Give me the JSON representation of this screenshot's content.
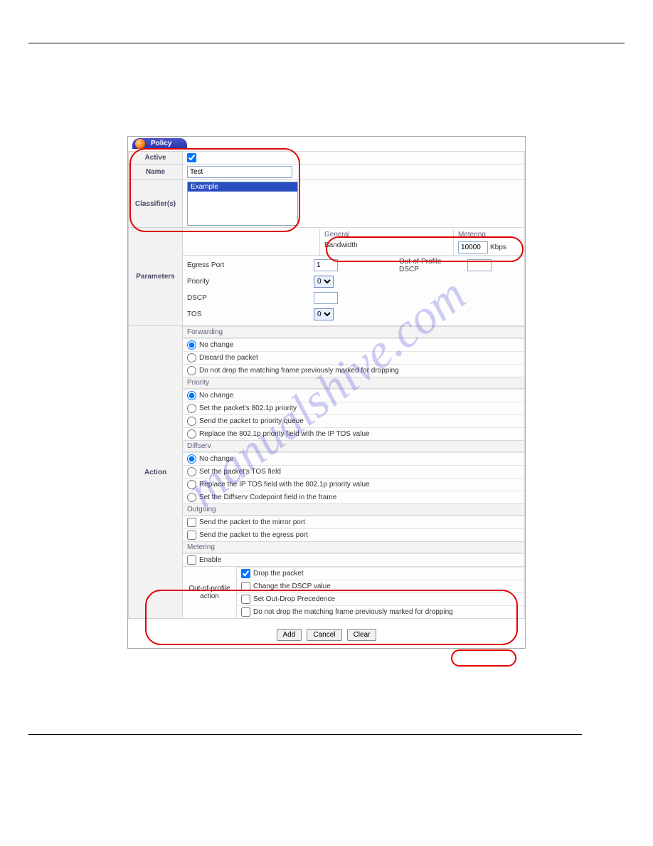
{
  "watermark": "manualshive.com",
  "tab_title": "Policy",
  "rows": {
    "active": {
      "label": "Active",
      "checked": true
    },
    "name": {
      "label": "Name",
      "value": "Test"
    },
    "classifiers": {
      "label": "Classifier(s)",
      "item": "Example"
    }
  },
  "parameters": {
    "label": "Parameters",
    "general": "General",
    "metering": "Metering",
    "bandwidth_label": "Bandwidth",
    "bandwidth_value": "10000",
    "bandwidth_unit": "Kbps",
    "egress_port": {
      "label": "Egress Port",
      "value": "1"
    },
    "out_of_profile_dscp": {
      "label": "Out-of-Profile DSCP",
      "value": ""
    },
    "priority": {
      "label": "Priority",
      "value": "0"
    },
    "dscp": {
      "label": "DSCP",
      "value": ""
    },
    "tos": {
      "label": "TOS",
      "value": "0"
    }
  },
  "action": {
    "label": "Action",
    "forwarding_hdr": "Forwarding",
    "forwarding": [
      "No change",
      "Discard the packet",
      "Do not drop the matching frame previously marked for dropping"
    ],
    "priority_hdr": "Priority",
    "priority": [
      "No change",
      "Set the packet's 802.1p priority",
      "Send the packet to priority queue",
      "Replace the 802.1p priority field with the IP TOS value"
    ],
    "diffserv_hdr": "Diffserv",
    "diffserv": [
      "No change",
      "Set the packet's TOS field",
      "Replace the IP TOS field with the 802.1p priority value",
      "Set the Diffserv Codepoint field in the frame"
    ],
    "outgoing_hdr": "Outgoing",
    "outgoing": [
      "Send the packet to the mirror port",
      "Send the packet to the egress port"
    ],
    "metering_hdr": "Metering",
    "metering_enable": "Enable",
    "oop_label1": "Out-of-profile",
    "oop_label2": "action",
    "oop": [
      "Drop the packet",
      "Change the DSCP value",
      "Set Out-Drop Precedence",
      "Do not drop the matching frame previously marked for dropping"
    ]
  },
  "buttons": {
    "add": "Add",
    "cancel": "Cancel",
    "clear": "Clear"
  }
}
